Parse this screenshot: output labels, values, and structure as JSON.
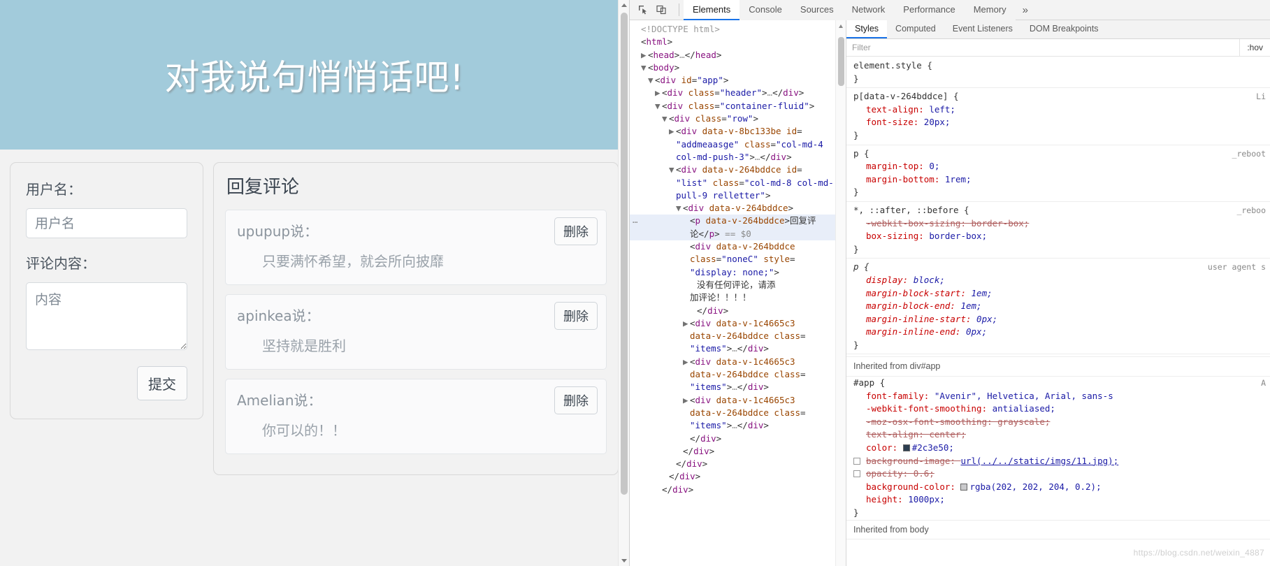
{
  "webpage": {
    "header_title": "对我说句悄悄话吧!",
    "header_bg": "#a2cbdb",
    "form": {
      "username_label": "用户名：",
      "username_placeholder": "用户名",
      "username_value": "",
      "content_label": "评论内容：",
      "content_placeholder": "内容",
      "content_value": "",
      "submit_label": "提交"
    },
    "list": {
      "title": "回复评论",
      "delete_label": "删除",
      "comments": [
        {
          "user": "upupup说：",
          "text": "只要满怀希望，就会所向披靡"
        },
        {
          "user": "apinkea说：",
          "text": "坚持就是胜利"
        },
        {
          "user": "Amelian说：",
          "text": "你可以的！！"
        }
      ]
    }
  },
  "devtools": {
    "toolbar_icons": [
      "inspect-element-icon",
      "device-toolbar-icon"
    ],
    "tabs": [
      {
        "label": "Elements",
        "active": true
      },
      {
        "label": "Console",
        "active": false
      },
      {
        "label": "Sources",
        "active": false
      },
      {
        "label": "Network",
        "active": false
      },
      {
        "label": "Performance",
        "active": false
      },
      {
        "label": "Memory",
        "active": false
      }
    ],
    "more_tabs_label": "»",
    "dom_lines": [
      {
        "indent": 0,
        "tri": "",
        "parts": [
          {
            "t": "dim",
            "v": "<!DOCTYPE html>"
          }
        ]
      },
      {
        "indent": 0,
        "tri": "",
        "parts": [
          {
            "t": "punc",
            "v": "<"
          },
          {
            "t": "tag",
            "v": "html"
          },
          {
            "t": "punc",
            "v": ">"
          }
        ]
      },
      {
        "indent": 1,
        "tri": "▶",
        "parts": [
          {
            "t": "punc",
            "v": "<"
          },
          {
            "t": "tag",
            "v": "head"
          },
          {
            "t": "punc",
            "v": ">"
          },
          {
            "t": "dim",
            "v": "…"
          },
          {
            "t": "punc",
            "v": "</"
          },
          {
            "t": "tag",
            "v": "head"
          },
          {
            "t": "punc",
            "v": ">"
          }
        ]
      },
      {
        "indent": 1,
        "tri": "▼",
        "parts": [
          {
            "t": "punc",
            "v": "<"
          },
          {
            "t": "tag",
            "v": "body"
          },
          {
            "t": "punc",
            "v": ">"
          }
        ]
      },
      {
        "indent": 2,
        "tri": "▼",
        "parts": [
          {
            "t": "punc",
            "v": "<"
          },
          {
            "t": "tag",
            "v": "div"
          },
          {
            "t": "attr",
            "v": " id"
          },
          {
            "t": "punc",
            "v": "="
          },
          {
            "t": "val",
            "v": "\"app\""
          },
          {
            "t": "punc",
            "v": ">"
          }
        ]
      },
      {
        "indent": 3,
        "tri": "▶",
        "parts": [
          {
            "t": "punc",
            "v": "<"
          },
          {
            "t": "tag",
            "v": "div"
          },
          {
            "t": "attr",
            "v": " class"
          },
          {
            "t": "punc",
            "v": "="
          },
          {
            "t": "val",
            "v": "\"header\""
          },
          {
            "t": "punc",
            "v": ">"
          },
          {
            "t": "dim",
            "v": "…"
          },
          {
            "t": "punc",
            "v": "</"
          },
          {
            "t": "tag",
            "v": "div"
          },
          {
            "t": "punc",
            "v": ">"
          }
        ]
      },
      {
        "indent": 3,
        "tri": "▼",
        "parts": [
          {
            "t": "punc",
            "v": "<"
          },
          {
            "t": "tag",
            "v": "div"
          },
          {
            "t": "attr",
            "v": " class"
          },
          {
            "t": "punc",
            "v": "="
          },
          {
            "t": "val",
            "v": "\"container-fluid\""
          },
          {
            "t": "punc",
            "v": ">"
          }
        ]
      },
      {
        "indent": 4,
        "tri": "▼",
        "parts": [
          {
            "t": "punc",
            "v": "<"
          },
          {
            "t": "tag",
            "v": "div"
          },
          {
            "t": "attr",
            "v": " class"
          },
          {
            "t": "punc",
            "v": "="
          },
          {
            "t": "val",
            "v": "\"row\""
          },
          {
            "t": "punc",
            "v": ">"
          }
        ]
      },
      {
        "indent": 5,
        "tri": "▶",
        "parts": [
          {
            "t": "punc",
            "v": "<"
          },
          {
            "t": "tag",
            "v": "div"
          },
          {
            "t": "attr",
            "v": " data-v-8bc133be"
          },
          {
            "t": "attr",
            "v": " id"
          },
          {
            "t": "punc",
            "v": "="
          }
        ]
      },
      {
        "indent": 5,
        "tri": "",
        "parts": [
          {
            "t": "val",
            "v": "\"addmeaasge\""
          },
          {
            "t": "attr",
            "v": " class"
          },
          {
            "t": "punc",
            "v": "="
          },
          {
            "t": "val",
            "v": "\"col-md-4"
          }
        ]
      },
      {
        "indent": 5,
        "tri": "",
        "parts": [
          {
            "t": "val",
            "v": "col-md-push-3\""
          },
          {
            "t": "punc",
            "v": ">"
          },
          {
            "t": "dim",
            "v": "…"
          },
          {
            "t": "punc",
            "v": "</"
          },
          {
            "t": "tag",
            "v": "div"
          },
          {
            "t": "punc",
            "v": ">"
          }
        ]
      },
      {
        "indent": 5,
        "tri": "▼",
        "parts": [
          {
            "t": "punc",
            "v": "<"
          },
          {
            "t": "tag",
            "v": "div"
          },
          {
            "t": "attr",
            "v": " data-v-264bddce"
          },
          {
            "t": "attr",
            "v": " id"
          },
          {
            "t": "punc",
            "v": "="
          }
        ]
      },
      {
        "indent": 5,
        "tri": "",
        "parts": [
          {
            "t": "val",
            "v": "\"list\""
          },
          {
            "t": "attr",
            "v": " class"
          },
          {
            "t": "punc",
            "v": "="
          },
          {
            "t": "val",
            "v": "\"col-md-8 col-md-"
          }
        ]
      },
      {
        "indent": 5,
        "tri": "",
        "parts": [
          {
            "t": "val",
            "v": "pull-9 relletter\""
          },
          {
            "t": "punc",
            "v": ">"
          }
        ]
      },
      {
        "indent": 6,
        "tri": "▼",
        "parts": [
          {
            "t": "punc",
            "v": "<"
          },
          {
            "t": "tag",
            "v": "div"
          },
          {
            "t": "attr",
            "v": " data-v-264bddce"
          },
          {
            "t": "punc",
            "v": ">"
          }
        ]
      },
      {
        "indent": 7,
        "tri": "",
        "sel": true,
        "dots": true,
        "parts": [
          {
            "t": "punc",
            "v": "<"
          },
          {
            "t": "tag",
            "v": "p"
          },
          {
            "t": "attr",
            "v": " data-v-264bddce"
          },
          {
            "t": "punc",
            "v": ">"
          },
          {
            "t": "txtn",
            "v": "回复评"
          }
        ]
      },
      {
        "indent": 7,
        "tri": "",
        "sel": true,
        "parts": [
          {
            "t": "txtn",
            "v": "论"
          },
          {
            "t": "punc",
            "v": "</"
          },
          {
            "t": "tag",
            "v": "p"
          },
          {
            "t": "punc",
            "v": ">"
          },
          {
            "t": "dollar",
            "v": " == $0"
          }
        ]
      },
      {
        "indent": 7,
        "tri": "",
        "parts": [
          {
            "t": "punc",
            "v": "<"
          },
          {
            "t": "tag",
            "v": "div"
          },
          {
            "t": "attr",
            "v": " data-v-264bddce"
          }
        ]
      },
      {
        "indent": 7,
        "tri": "",
        "parts": [
          {
            "t": "attr",
            "v": "class"
          },
          {
            "t": "punc",
            "v": "="
          },
          {
            "t": "val",
            "v": "\"noneC\""
          },
          {
            "t": "attr",
            "v": " style"
          },
          {
            "t": "punc",
            "v": "="
          }
        ]
      },
      {
        "indent": 7,
        "tri": "",
        "parts": [
          {
            "t": "val",
            "v": "\"display: none;\""
          },
          {
            "t": "punc",
            "v": ">"
          }
        ]
      },
      {
        "indent": 8,
        "tri": "",
        "parts": [
          {
            "t": "txtn",
            "v": "没有任何评论，请添"
          }
        ]
      },
      {
        "indent": 7,
        "tri": "",
        "parts": [
          {
            "t": "txtn",
            "v": "加评论！！！！"
          }
        ]
      },
      {
        "indent": 8,
        "tri": "",
        "parts": [
          {
            "t": "punc",
            "v": "</"
          },
          {
            "t": "tag",
            "v": "div"
          },
          {
            "t": "punc",
            "v": ">"
          }
        ]
      },
      {
        "indent": 7,
        "tri": "▶",
        "parts": [
          {
            "t": "punc",
            "v": "<"
          },
          {
            "t": "tag",
            "v": "div"
          },
          {
            "t": "attr",
            "v": " data-v-1c4665c3"
          }
        ]
      },
      {
        "indent": 7,
        "tri": "",
        "parts": [
          {
            "t": "attr",
            "v": "data-v-264bddce"
          },
          {
            "t": "attr",
            "v": " class"
          },
          {
            "t": "punc",
            "v": "="
          }
        ]
      },
      {
        "indent": 7,
        "tri": "",
        "parts": [
          {
            "t": "val",
            "v": "\"items\""
          },
          {
            "t": "punc",
            "v": ">"
          },
          {
            "t": "dim",
            "v": "…"
          },
          {
            "t": "punc",
            "v": "</"
          },
          {
            "t": "tag",
            "v": "div"
          },
          {
            "t": "punc",
            "v": ">"
          }
        ]
      },
      {
        "indent": 7,
        "tri": "▶",
        "parts": [
          {
            "t": "punc",
            "v": "<"
          },
          {
            "t": "tag",
            "v": "div"
          },
          {
            "t": "attr",
            "v": " data-v-1c4665c3"
          }
        ]
      },
      {
        "indent": 7,
        "tri": "",
        "parts": [
          {
            "t": "attr",
            "v": "data-v-264bddce"
          },
          {
            "t": "attr",
            "v": " class"
          },
          {
            "t": "punc",
            "v": "="
          }
        ]
      },
      {
        "indent": 7,
        "tri": "",
        "parts": [
          {
            "t": "val",
            "v": "\"items\""
          },
          {
            "t": "punc",
            "v": ">"
          },
          {
            "t": "dim",
            "v": "…"
          },
          {
            "t": "punc",
            "v": "</"
          },
          {
            "t": "tag",
            "v": "div"
          },
          {
            "t": "punc",
            "v": ">"
          }
        ]
      },
      {
        "indent": 7,
        "tri": "▶",
        "parts": [
          {
            "t": "punc",
            "v": "<"
          },
          {
            "t": "tag",
            "v": "div"
          },
          {
            "t": "attr",
            "v": " data-v-1c4665c3"
          }
        ]
      },
      {
        "indent": 7,
        "tri": "",
        "parts": [
          {
            "t": "attr",
            "v": "data-v-264bddce"
          },
          {
            "t": "attr",
            "v": " class"
          },
          {
            "t": "punc",
            "v": "="
          }
        ]
      },
      {
        "indent": 7,
        "tri": "",
        "parts": [
          {
            "t": "val",
            "v": "\"items\""
          },
          {
            "t": "punc",
            "v": ">"
          },
          {
            "t": "dim",
            "v": "…"
          },
          {
            "t": "punc",
            "v": "</"
          },
          {
            "t": "tag",
            "v": "div"
          },
          {
            "t": "punc",
            "v": ">"
          }
        ]
      },
      {
        "indent": 7,
        "tri": "",
        "parts": [
          {
            "t": "punc",
            "v": "</"
          },
          {
            "t": "tag",
            "v": "div"
          },
          {
            "t": "punc",
            "v": ">"
          }
        ]
      },
      {
        "indent": 6,
        "tri": "",
        "parts": [
          {
            "t": "punc",
            "v": "</"
          },
          {
            "t": "tag",
            "v": "div"
          },
          {
            "t": "punc",
            "v": ">"
          }
        ]
      },
      {
        "indent": 5,
        "tri": "",
        "parts": [
          {
            "t": "punc",
            "v": "</"
          },
          {
            "t": "tag",
            "v": "div"
          },
          {
            "t": "punc",
            "v": ">"
          }
        ]
      },
      {
        "indent": 4,
        "tri": "",
        "parts": [
          {
            "t": "punc",
            "v": "</"
          },
          {
            "t": "tag",
            "v": "div"
          },
          {
            "t": "punc",
            "v": ">"
          }
        ]
      },
      {
        "indent": 3,
        "tri": "",
        "parts": [
          {
            "t": "punc",
            "v": "</"
          },
          {
            "t": "tag",
            "v": "div"
          },
          {
            "t": "punc",
            "v": ">"
          }
        ]
      }
    ],
    "styles": {
      "tabs": [
        {
          "label": "Styles",
          "active": true
        },
        {
          "label": "Computed",
          "active": false
        },
        {
          "label": "Event Listeners",
          "active": false
        },
        {
          "label": "DOM Breakpoints",
          "active": false
        }
      ],
      "filter_placeholder": "Filter",
      "hov_label": ":hov",
      "rules": [
        {
          "selector": "element.style {",
          "origin": "",
          "props": [],
          "close": "}"
        },
        {
          "selector": "p[data-v-264bddce] {",
          "origin": "Li",
          "props": [
            {
              "name": "text-align",
              "value": "left;",
              "strike": false
            },
            {
              "name": "font-size",
              "value": "20px;",
              "strike": false
            }
          ],
          "close": "}"
        },
        {
          "selector": "p {",
          "origin": "_reboot",
          "props": [
            {
              "name": "margin-top",
              "value": "0;",
              "strike": false
            },
            {
              "name": "margin-bottom",
              "value": "1rem;",
              "strike": false
            }
          ],
          "close": "}"
        },
        {
          "selector": "*, ::after, ::before {",
          "origin": "_reboo",
          "props": [
            {
              "name": "-webkit-box-sizing",
              "value": "border-box;",
              "strike": true
            },
            {
              "name": "box-sizing",
              "value": "border-box;",
              "strike": false
            }
          ],
          "close": "}"
        },
        {
          "selector": "p {",
          "origin": "user agent s",
          "italic": true,
          "props": [
            {
              "name": "display",
              "value": "block;",
              "strike": false
            },
            {
              "name": "margin-block-start",
              "value": "1em;",
              "strike": false
            },
            {
              "name": "margin-block-end",
              "value": "1em;",
              "strike": false
            },
            {
              "name": "margin-inline-start",
              "value": "0px;",
              "strike": false
            },
            {
              "name": "margin-inline-end",
              "value": "0px;",
              "strike": false
            }
          ],
          "close": "}"
        }
      ],
      "inherited_app_header": "Inherited from div#app",
      "app_rule": {
        "selector": "#app {",
        "origin": "A",
        "props": [
          {
            "name": "font-family",
            "value": "\"Avenir\", Helvetica, Arial, sans-s",
            "strike": false
          },
          {
            "name": "-webkit-font-smoothing",
            "value": "antialiased;",
            "strike": false
          },
          {
            "name": "-moz-osx-font-smoothing",
            "value": "grayscale;",
            "strike": true
          },
          {
            "name": "text-align",
            "value": "center;",
            "strike": true
          },
          {
            "name": "color",
            "value": "#2c3e50;",
            "strike": false,
            "swatch": "#2c3e50"
          },
          {
            "name": "background-image",
            "value": "url(../../static/imgs/11.jpg);",
            "strike": true,
            "checkbox": true,
            "link": true
          },
          {
            "name": "opacity",
            "value": "0.6;",
            "strike": true,
            "checkbox": true
          },
          {
            "name": "background-color",
            "value": "rgba(202, 202, 204, 0.2);",
            "strike": false,
            "swatch": "#cacacc"
          },
          {
            "name": "height",
            "value": "1000px;",
            "strike": false
          }
        ],
        "close": "}"
      },
      "inherited_body_header": "Inherited from body"
    },
    "watermark": "https://blog.csdn.net/weixin_4887"
  }
}
